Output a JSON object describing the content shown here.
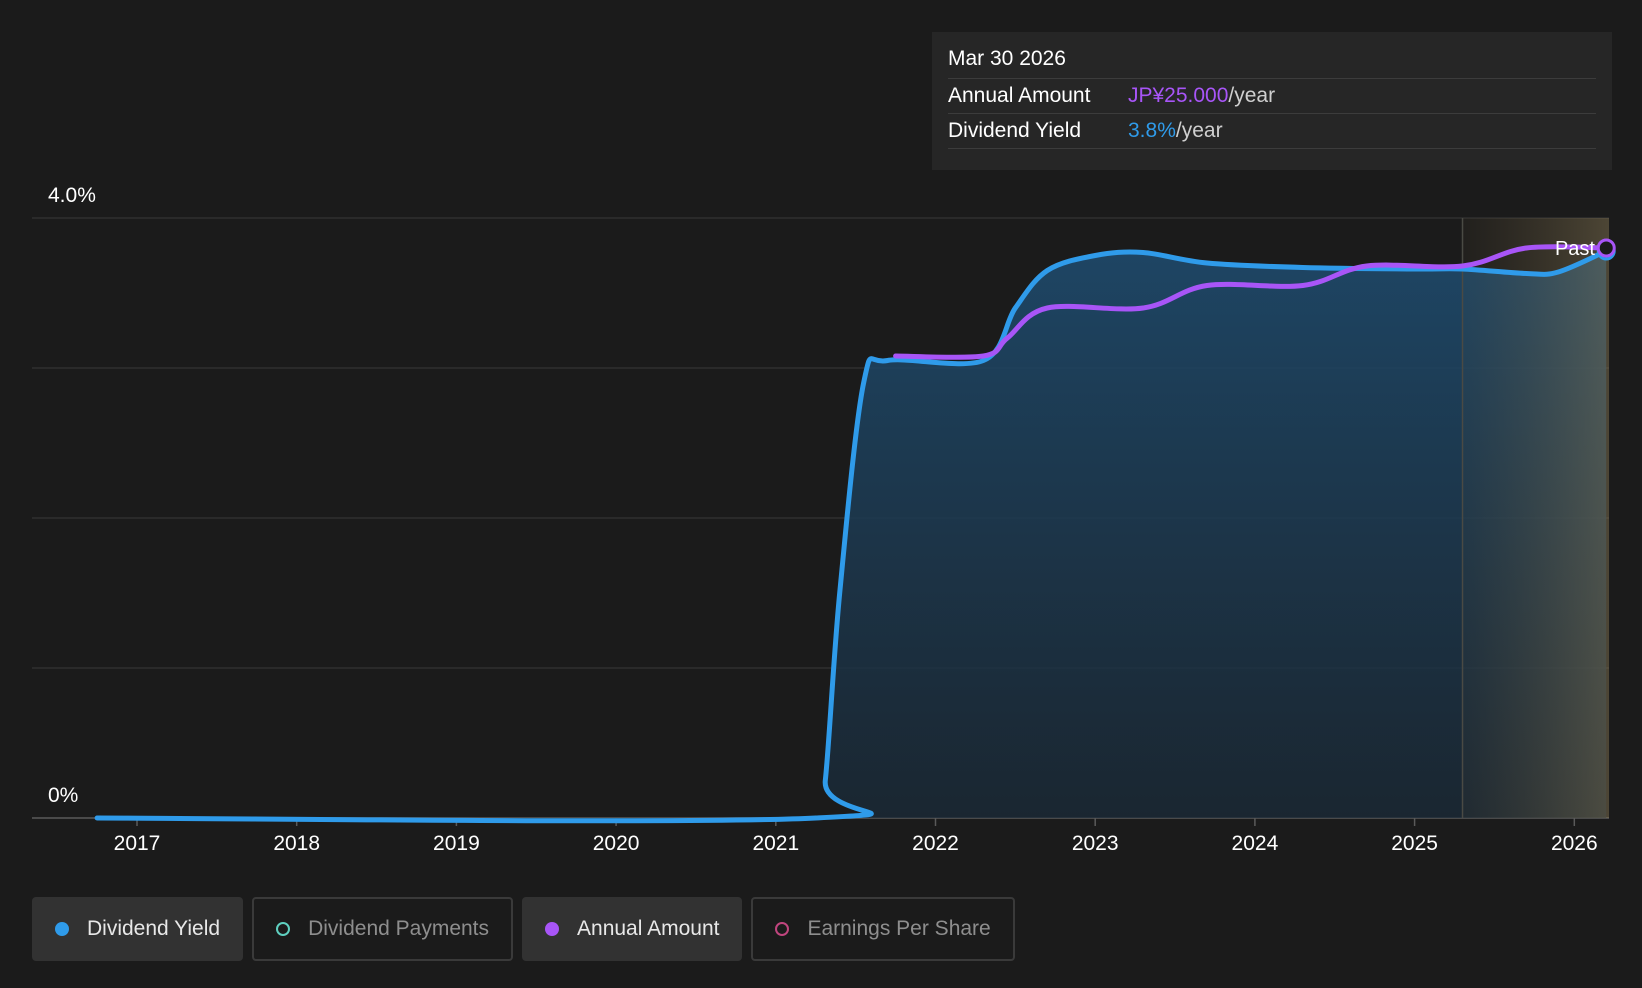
{
  "tooltip": {
    "date": "Mar 30 2026",
    "rows": [
      {
        "label": "Annual Amount",
        "value": "JP¥25.000",
        "unit": "/year",
        "color": "#a855f7"
      },
      {
        "label": "Dividend Yield",
        "value": "3.8%",
        "unit": "/year",
        "color": "#2f9bea"
      }
    ]
  },
  "legend": [
    {
      "label": "Dividend Yield",
      "color": "#2f9bea",
      "active": true,
      "filled": true
    },
    {
      "label": "Dividend Payments",
      "color": "#5fd0c0",
      "active": false,
      "filled": false
    },
    {
      "label": "Annual Amount",
      "color": "#a855f7",
      "active": true,
      "filled": true
    },
    {
      "label": "Earnings Per Share",
      "color": "#c0457e",
      "active": false,
      "filled": false
    }
  ],
  "chart_data": {
    "type": "line",
    "ylim": [
      0,
      4.0
    ],
    "y_tick_labels": [
      "4.0%",
      "0%"
    ],
    "x_tick_labels": [
      "2017",
      "2018",
      "2019",
      "2020",
      "2021",
      "2022",
      "2023",
      "2024",
      "2025",
      "2026"
    ],
    "grid": true,
    "forecast_label": "Past",
    "forecast_start": 2025.3,
    "series": [
      {
        "name": "Dividend Yield",
        "color": "#2f9bea",
        "points": [
          [
            2016.75,
            0
          ],
          [
            2021.25,
            0
          ],
          [
            2021.31,
            0.25
          ],
          [
            2021.4,
            1.5
          ],
          [
            2021.55,
            2.9
          ],
          [
            2021.7,
            3.05
          ],
          [
            2022.3,
            3.05
          ],
          [
            2022.5,
            3.4
          ],
          [
            2022.7,
            3.65
          ],
          [
            2023.0,
            3.75
          ],
          [
            2023.3,
            3.77
          ],
          [
            2023.7,
            3.7
          ],
          [
            2024.3,
            3.67
          ],
          [
            2025.0,
            3.66
          ],
          [
            2025.3,
            3.66
          ],
          [
            2025.7,
            3.63
          ],
          [
            2025.9,
            3.64
          ],
          [
            2026.2,
            3.78
          ]
        ]
      },
      {
        "name": "Annual Amount",
        "color": "#a855f7",
        "points": [
          [
            2021.75,
            3.08
          ],
          [
            2022.3,
            3.08
          ],
          [
            2022.45,
            3.2
          ],
          [
            2022.7,
            3.4
          ],
          [
            2023.3,
            3.4
          ],
          [
            2023.7,
            3.55
          ],
          [
            2024.3,
            3.55
          ],
          [
            2024.7,
            3.68
          ],
          [
            2025.3,
            3.68
          ],
          [
            2025.7,
            3.8
          ],
          [
            2026.2,
            3.8
          ]
        ]
      }
    ]
  }
}
